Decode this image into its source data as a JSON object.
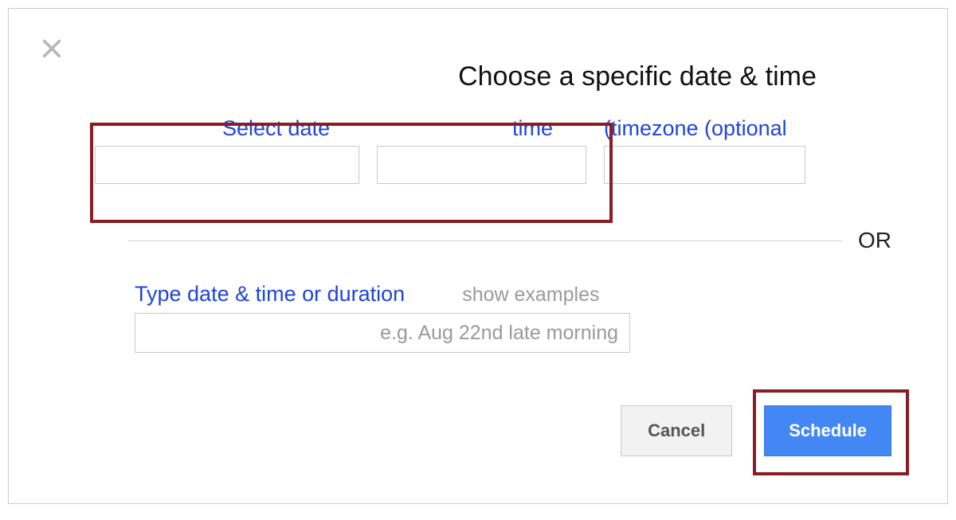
{
  "dialog": {
    "title": "Choose a specific date & time"
  },
  "fields": {
    "date_label": "Select date",
    "date_value": "",
    "time_label": "time",
    "time_value": "",
    "timezone_label": "(timezone (optional",
    "timezone_value": ""
  },
  "or_text": "OR",
  "type_section": {
    "label": "Type date & time or duration",
    "show_examples": "show examples",
    "placeholder": "e.g. Aug 22nd late morning",
    "value": ""
  },
  "buttons": {
    "cancel": "Cancel",
    "schedule": "Schedule"
  }
}
